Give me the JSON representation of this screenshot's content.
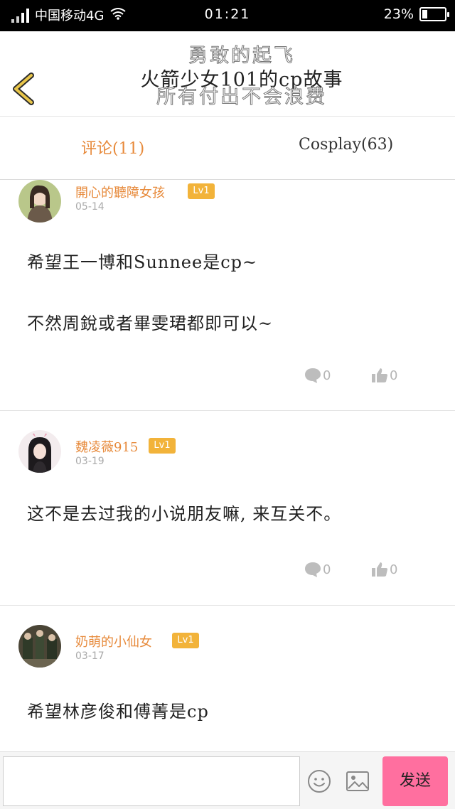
{
  "status_bar": {
    "carrier": "中国移动4G",
    "time": "01:21",
    "battery_percent": "23%",
    "battery_level": 0.23
  },
  "header": {
    "title_lines": [
      "勇敢的起飞",
      "火箭少女101的cp故事",
      "所有付出不会浪费"
    ]
  },
  "tabs": [
    {
      "label": "评论(11)",
      "active": true
    },
    {
      "label": "Cosplay(63)",
      "active": false
    }
  ],
  "comments": [
    {
      "user": "開心的聽障女孩",
      "level": "Lv1",
      "date": "05-14",
      "lines": [
        "希望王一博和Sunnee是cp~",
        "不然周銳或者畢雯珺都即可以~"
      ],
      "reply_count": "0",
      "like_count": "0"
    },
    {
      "user": "魏凌薇915",
      "level": "Lv1",
      "date": "03-19",
      "lines": [
        "这不是去过我的小说朋友嘛, 来互关不。"
      ],
      "reply_count": "0",
      "like_count": "0"
    },
    {
      "user": "奶萌的小仙女",
      "level": "Lv1",
      "date": "03-17",
      "lines": [
        "希望林彦俊和傅菁是cp"
      ]
    }
  ],
  "bottom_bar": {
    "input_placeholder": "",
    "send_label": "发送"
  },
  "colors": {
    "accent": "#e78a3b",
    "level_badge": "#f2b33a",
    "send_button": "#ff6f9f"
  },
  "icons": [
    "back-arrow-icon",
    "comment-icon",
    "thumbs-up-icon",
    "emoji-icon",
    "image-icon"
  ]
}
